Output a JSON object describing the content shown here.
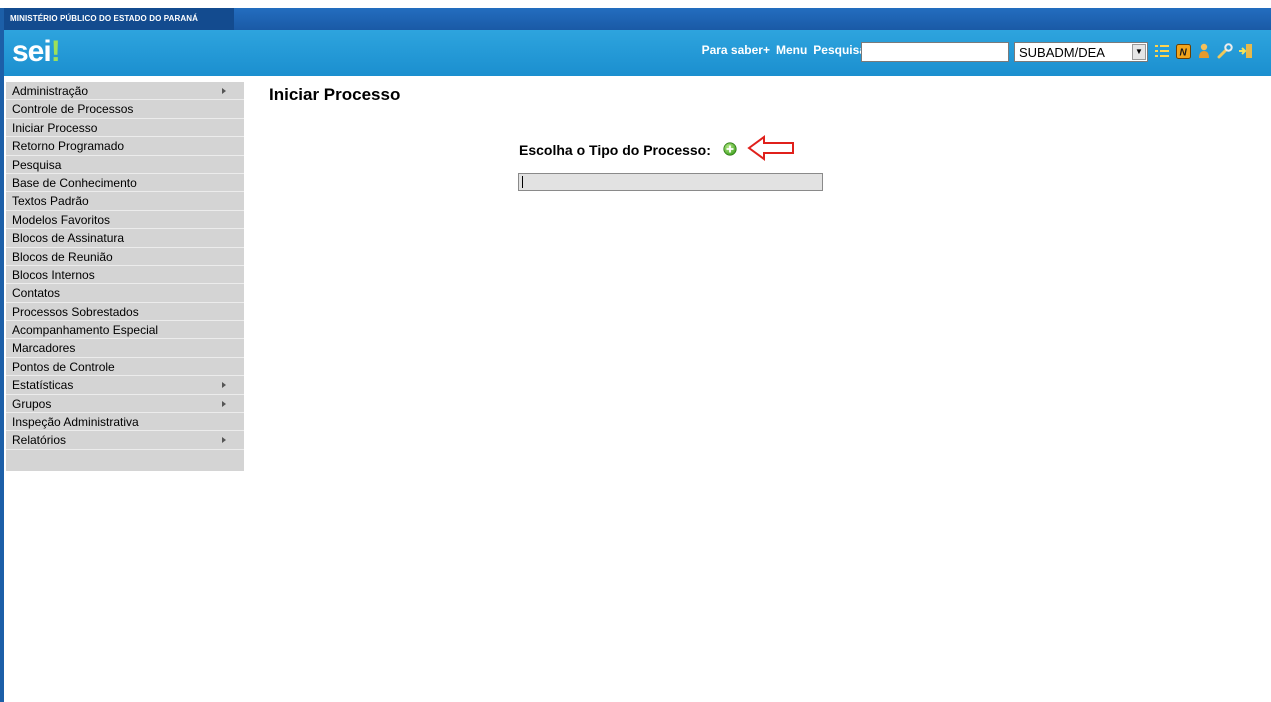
{
  "header": {
    "org_name": "MINISTÉRIO PÚBLICO DO ESTADO DO PARANÁ",
    "logo": {
      "main": "sei",
      "accent": "!"
    },
    "links": [
      "Para saber+",
      "Menu",
      "Pesquisa"
    ],
    "search": {
      "value": "",
      "placeholder": ""
    },
    "unit_select": {
      "selected": "SUBADM/DEA"
    },
    "toolbar_icons": [
      "list-view-icon",
      "notes-icon",
      "user-icon",
      "tools-icon",
      "exit-icon"
    ],
    "colors": {
      "org_bar": "#1a5aa6",
      "header_bar": "#1f93d2",
      "logo_accent": "#9ee05a"
    }
  },
  "sidebar": {
    "items": [
      {
        "label": "Administração",
        "submenu": true
      },
      {
        "label": "Controle de Processos",
        "submenu": false
      },
      {
        "label": "Iniciar Processo",
        "submenu": false
      },
      {
        "label": "Retorno Programado",
        "submenu": false
      },
      {
        "label": "Pesquisa",
        "submenu": false
      },
      {
        "label": "Base de Conhecimento",
        "submenu": false
      },
      {
        "label": "Textos Padrão",
        "submenu": false
      },
      {
        "label": "Modelos Favoritos",
        "submenu": false
      },
      {
        "label": "Blocos de Assinatura",
        "submenu": false
      },
      {
        "label": "Blocos de Reunião",
        "submenu": false
      },
      {
        "label": "Blocos Internos",
        "submenu": false
      },
      {
        "label": "Contatos",
        "submenu": false
      },
      {
        "label": "Processos Sobrestados",
        "submenu": false
      },
      {
        "label": "Acompanhamento Especial",
        "submenu": false
      },
      {
        "label": "Marcadores",
        "submenu": false
      },
      {
        "label": "Pontos de Controle",
        "submenu": false
      },
      {
        "label": "Estatísticas",
        "submenu": true
      },
      {
        "label": "Grupos",
        "submenu": true
      },
      {
        "label": "Inspeção Administrativa",
        "submenu": false
      },
      {
        "label": "Relatórios",
        "submenu": true
      }
    ]
  },
  "main": {
    "title": "Iniciar Processo",
    "choose_label": "Escolha o Tipo do Processo:",
    "type_input": {
      "value": ""
    },
    "annotation_color": "#e0201b"
  }
}
